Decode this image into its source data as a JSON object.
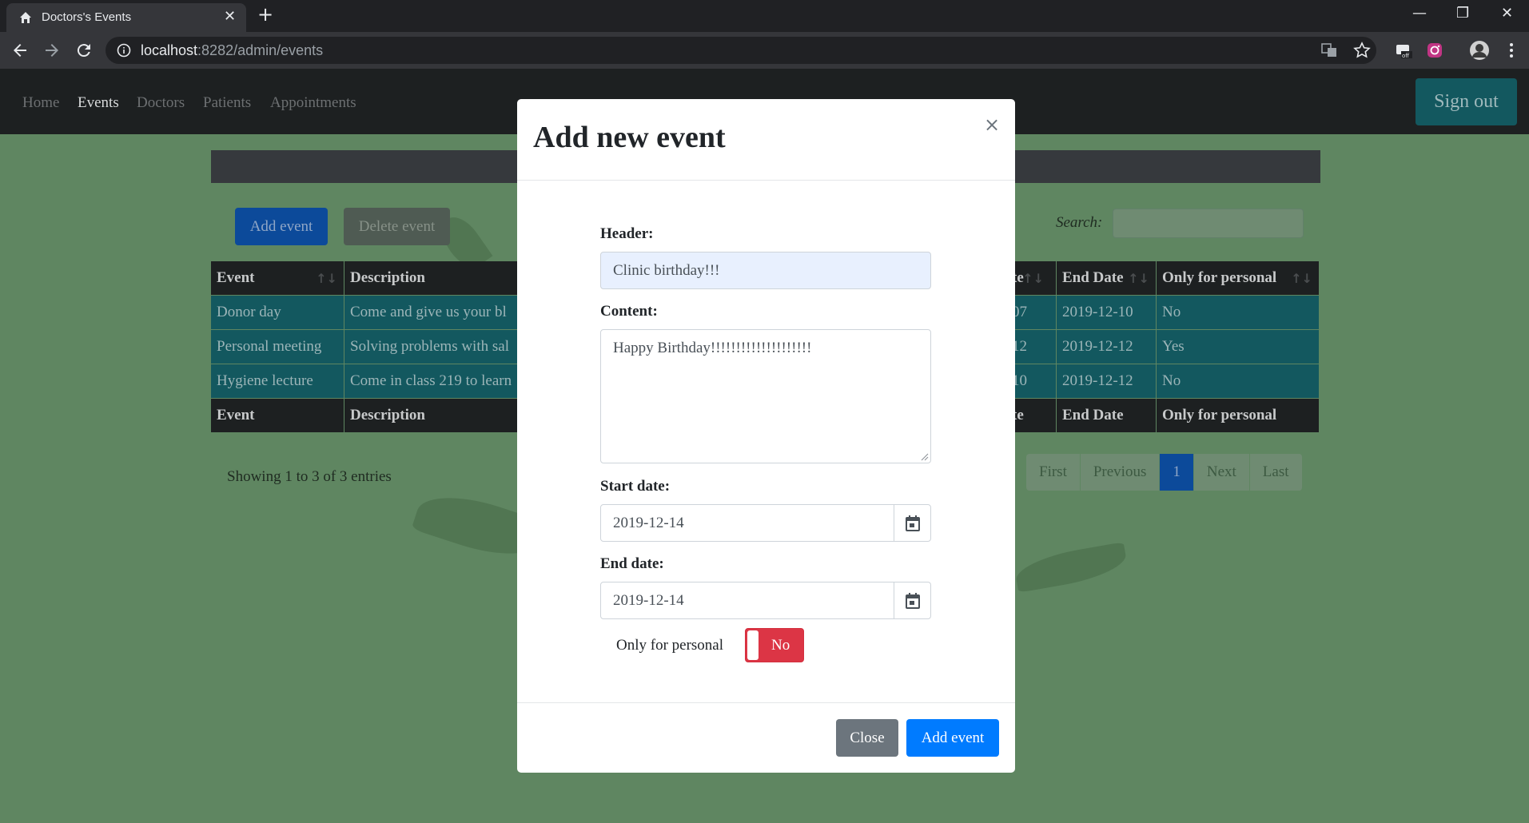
{
  "browser": {
    "tab_title": "Doctors's Events",
    "url_host": "localhost",
    "url_rest": ":8282/admin/events"
  },
  "nav": {
    "links": [
      "Home",
      "Events",
      "Doctors",
      "Patients",
      "Appointments"
    ],
    "active": "Events",
    "sign_out": "Sign out"
  },
  "toolbar": {
    "add_event": "Add event",
    "delete_event": "Delete event",
    "search_label": "Search:"
  },
  "table": {
    "columns": [
      "Event",
      "Description",
      "te",
      "End Date",
      "Only for personal"
    ],
    "rows": [
      [
        "Donor day",
        "Come and give us your bl",
        "07",
        "2019-12-10",
        "No"
      ],
      [
        "Personal meeting",
        "Solving problems with sal",
        "12",
        "2019-12-12",
        "Yes"
      ],
      [
        "Hygiene lecture",
        "Come in class 219 to learn",
        "10",
        "2019-12-12",
        "No"
      ]
    ],
    "info": "Showing 1 to 3 of 3 entries"
  },
  "pagination": {
    "first": "First",
    "previous": "Previous",
    "current": "1",
    "next": "Next",
    "last": "Last"
  },
  "modal": {
    "title": "Add new event",
    "close_x": "×",
    "header_label": "Header:",
    "header_value": "Clinic birthday!!!",
    "content_label": "Content:",
    "content_value": "Happy Birthday!!!!!!!!!!!!!!!!!!!!",
    "start_label": "Start date:",
    "start_value": "2019-12-14",
    "end_label": "End date:",
    "end_value": "2019-12-14",
    "personal_label": "Only for personal",
    "personal_value": "No",
    "close_button": "Close",
    "add_button": "Add event"
  },
  "colors": {
    "overlay_bg": "#5f8661",
    "primary": "#007bff",
    "secondary": "#6c757d",
    "danger": "#dc3545",
    "table_row": "#13585f"
  }
}
